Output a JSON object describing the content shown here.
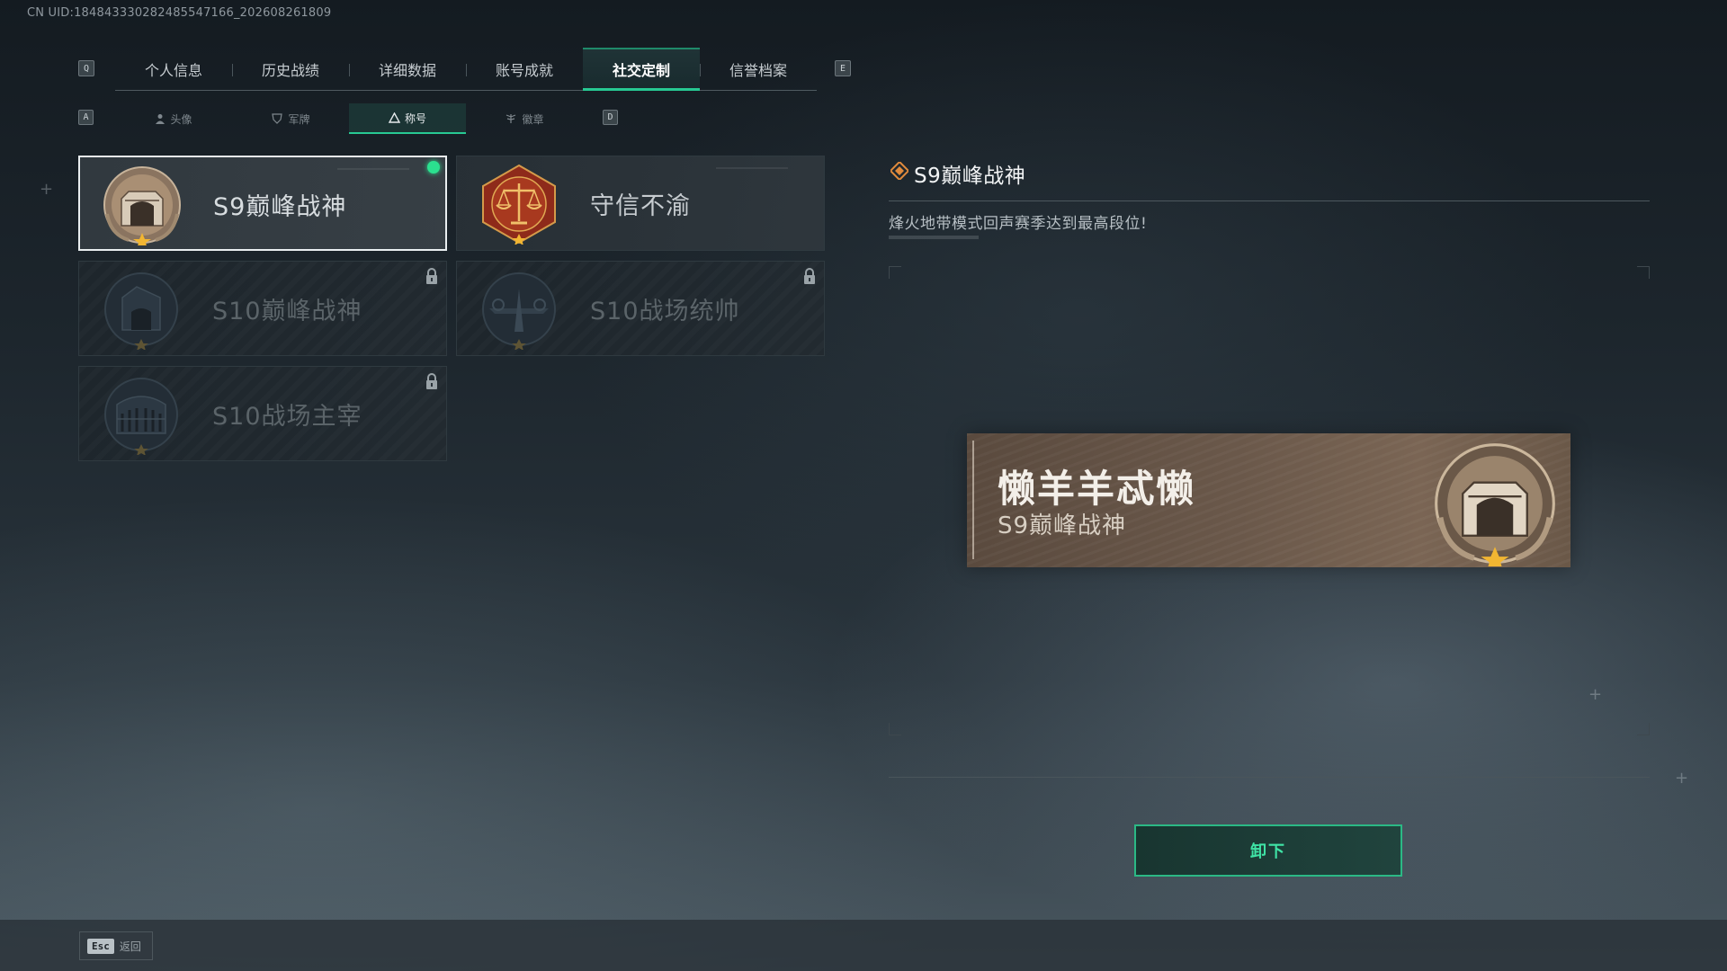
{
  "uid_text": "CN UID:1848433302824855471​66_202608261809",
  "main_tabs": {
    "left_key": "Q",
    "right_key": "E",
    "items": [
      "个人信息",
      "历史战绩",
      "详细数据",
      "账号成就",
      "社交定制",
      "信誉档案"
    ],
    "active": "社交定制"
  },
  "sub_tabs": {
    "left_key": "A",
    "right_key": "D",
    "items": [
      {
        "label": "头像",
        "icon": "person-icon"
      },
      {
        "label": "军牌",
        "icon": "shield-icon"
      },
      {
        "label": "称号",
        "icon": "triangle-icon"
      },
      {
        "label": "徽章",
        "icon": "wings-icon"
      }
    ],
    "active": "称号"
  },
  "titles": [
    {
      "name": "S9巅峰战神",
      "state": "equipped",
      "emblem": "fortress-emblem",
      "emblem_tone": "bronze"
    },
    {
      "name": "守信不渝",
      "state": "unlocked",
      "emblem": "scales-emblem",
      "emblem_tone": "red"
    },
    {
      "name": "S10巅峰战神",
      "state": "locked",
      "emblem": "fortress-emblem",
      "emblem_tone": "dark"
    },
    {
      "name": "S10战场统帅",
      "state": "locked",
      "emblem": "aircraft-emblem",
      "emblem_tone": "dark"
    },
    {
      "name": "S10战场主宰",
      "state": "locked",
      "emblem": "colosseum-emblem",
      "emblem_tone": "dark"
    }
  ],
  "detail": {
    "title": "S9巅峰战神",
    "description": "烽火地带模式回声赛季达到最高段位!"
  },
  "preview": {
    "player_name": "懒羊羊忒懒",
    "title": "S9巅峰战神"
  },
  "unequip_button": "卸下",
  "footer": {
    "esc_key": "Esc",
    "esc_label": "返回"
  },
  "colors": {
    "accent_green": "#27c993",
    "equipped_dot": "#2be08f",
    "preview_bg": "#6a584a"
  }
}
